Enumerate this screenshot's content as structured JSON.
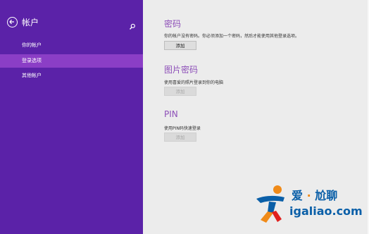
{
  "sidebar": {
    "title": "帐户",
    "items": [
      {
        "label": "你的帐户",
        "active": false
      },
      {
        "label": "登录选项",
        "active": true
      },
      {
        "label": "其他帐户",
        "active": false
      }
    ]
  },
  "main": {
    "password": {
      "title": "密码",
      "description": "你的帐户没有密码。你必须添加一个密码，然后才能使用其他登录选项。",
      "button": "添加"
    },
    "picture_password": {
      "title": "图片密码",
      "description": "使用喜爱的照片登录到你的电脑",
      "button": "添加"
    },
    "pin": {
      "title": "PIN",
      "description": "使用PIN码快速登录",
      "button": "添加"
    }
  },
  "watermark": {
    "brand_left": "爱",
    "separator": "·",
    "brand_right": "尬聊",
    "url": "igaliao.com"
  },
  "colors": {
    "sidebar_bg": "#5b22a8",
    "active_item": "#8b3ec6",
    "content_bg": "#ececec",
    "section_title": "#8d4fb8",
    "watermark_blue": "#0a5fa8",
    "watermark_orange": "#f08a18"
  },
  "icons": {
    "back": "back-arrow-circle-icon",
    "search": "search-icon",
    "logo": "running-figure-logo"
  }
}
